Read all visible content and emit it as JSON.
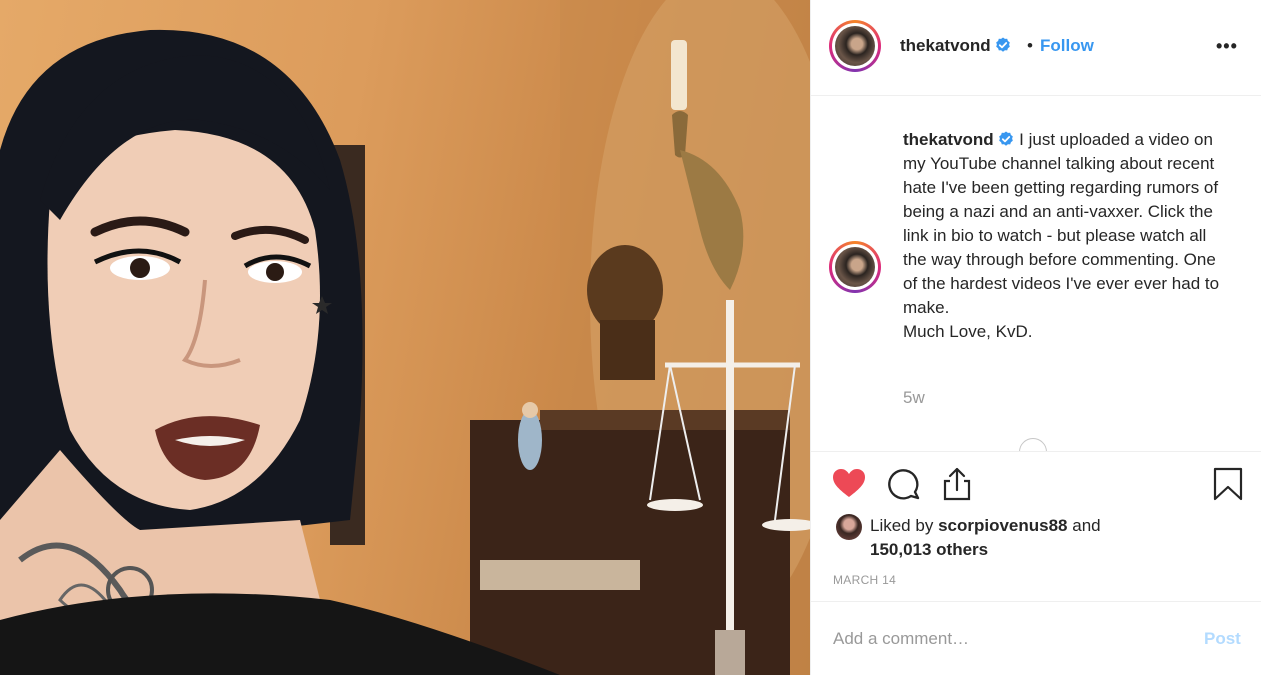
{
  "header": {
    "username": "thekatvond",
    "separator": "•",
    "follow_label": "Follow",
    "more_label": "•••"
  },
  "caption": {
    "username": "thekatvond",
    "text": "I just uploaded a video on my YouTube channel talking about recent hate I've been getting regarding rumors of being a nazi and an anti-vaxxer. Click the link in bio to watch - but please watch all the way through before commenting. One of the hardest videos I've ever ever had to make.",
    "signoff": "Much Love, KvD.",
    "time_ago": "5w"
  },
  "actions": {
    "like_icon": "heart-filled-icon",
    "comment_icon": "comment-bubble-icon",
    "share_icon": "share-icon",
    "save_icon": "bookmark-icon",
    "like_color": "#ed4956"
  },
  "likes": {
    "prefix": "Liked by",
    "user": "scorpiovenus88",
    "conjunction": "and",
    "count_text": "150,013 others"
  },
  "post_date": "MARCH 14",
  "comment": {
    "placeholder": "Add a comment…",
    "post_label": "Post"
  },
  "colors": {
    "link": "#3897f0",
    "verified": "#3897f0",
    "muted": "#999999",
    "post_disabled": "#b3dbff"
  }
}
